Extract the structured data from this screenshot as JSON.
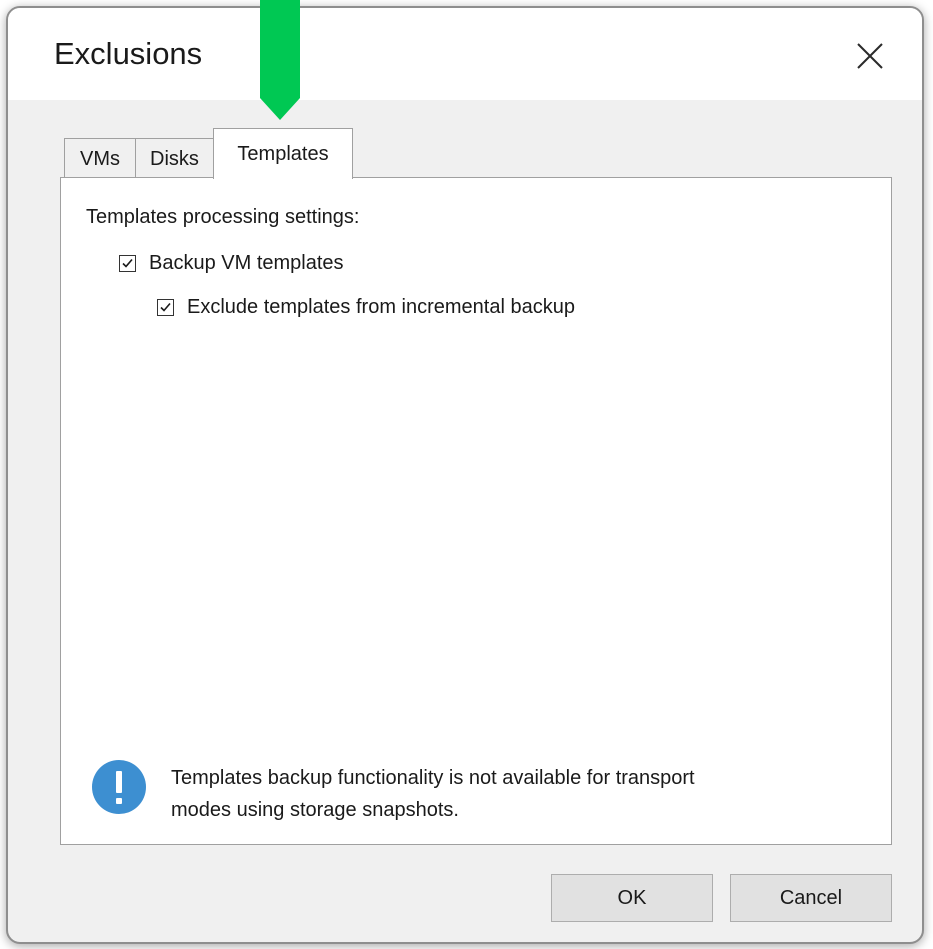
{
  "window": {
    "title": "Exclusions",
    "close_icon": "close-icon"
  },
  "tabs": [
    {
      "label": "VMs",
      "active": false
    },
    {
      "label": "Disks",
      "active": false
    },
    {
      "label": "Templates",
      "active": true
    }
  ],
  "templates_panel": {
    "settings_label": "Templates processing settings:",
    "backup_vm_templates": {
      "label": "Backup VM templates",
      "checked": true
    },
    "exclude_incremental": {
      "label": "Exclude templates from incremental backup",
      "checked": true
    },
    "info": {
      "icon": "info-exclamation-icon",
      "line1": "Templates backup functionality is not available for transport",
      "line2": "modes using storage snapshots."
    }
  },
  "buttons": {
    "ok": "OK",
    "cancel": "Cancel"
  },
  "colors": {
    "annotation_arrow": "#00c853",
    "info_icon": "#3d8fd1",
    "checkbox_checked_border": "#333333"
  }
}
